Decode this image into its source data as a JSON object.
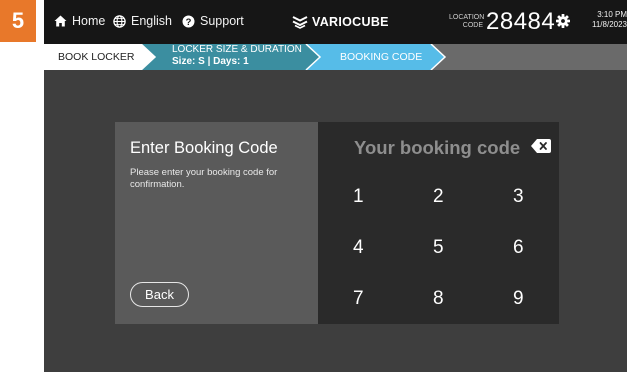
{
  "step_badge": "5",
  "topbar": {
    "home_label": "Home",
    "language_label": "English",
    "support_label": "Support",
    "brand": "VARIOCUBE",
    "location_label_line1": "LOCATION",
    "location_label_line2": "CODE",
    "location_code": "28484",
    "time": "3:10 PM",
    "date": "11/8/2023"
  },
  "breadcrumb": {
    "step1": "BOOK LOCKER",
    "step2_title": "LOCKER SIZE & DURATION",
    "step2_detail": "Size: S | Days: 1",
    "step3": "BOOKING CODE"
  },
  "colors": {
    "accent_orange": "#e8782a",
    "crumb_teal": "#3b8ea0",
    "crumb_blue": "#56bce8"
  },
  "booking": {
    "title": "Enter Booking Code",
    "subtitle": "Please enter your booking code for confirmation.",
    "back_label": "Back",
    "code_placeholder": "Your booking code"
  },
  "keypad": {
    "keys": [
      "1",
      "2",
      "3",
      "4",
      "5",
      "6",
      "7",
      "8",
      "9"
    ]
  }
}
